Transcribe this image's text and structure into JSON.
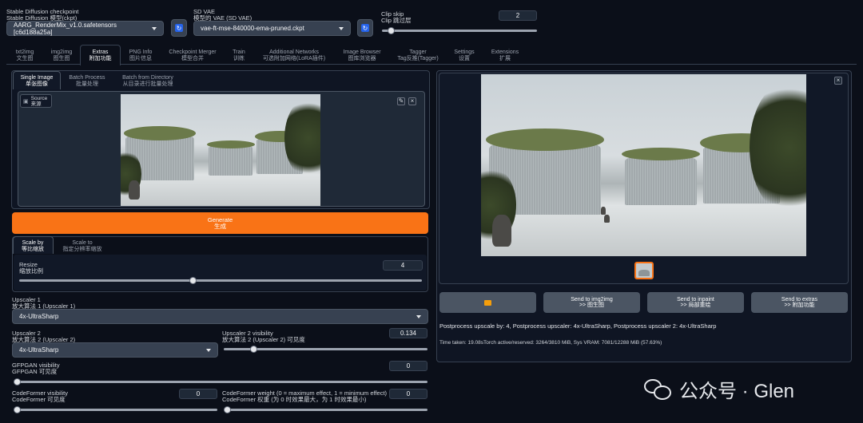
{
  "top": {
    "checkpoint_label_en": "Stable Diffusion checkpoint",
    "checkpoint_label_zh": "Stable Diffusion 模型(ckpt)",
    "checkpoint_value": "AARG_RenderMix_v1.0.safetensors [c6d188a25a]",
    "vae_label_en": "SD VAE",
    "vae_label_zh": "模型的 VAE (SD VAE)",
    "vae_value": "vae-ft-mse-840000-ema-pruned.ckpt",
    "clip_label_en": "Clip skip",
    "clip_label_zh": "Clip 跳过层",
    "clip_value": "2",
    "clip_fraction": 0.04
  },
  "tabs": [
    {
      "en": "txt2img",
      "zh": "文生图"
    },
    {
      "en": "img2img",
      "zh": "图生图"
    },
    {
      "en": "Extras",
      "zh": "附加功能"
    },
    {
      "en": "PNG Info",
      "zh": "图片信息"
    },
    {
      "en": "Checkpoint Merger",
      "zh": "模型合并"
    },
    {
      "en": "Train",
      "zh": "训练"
    },
    {
      "en": "Additional Networks",
      "zh": "可选附加网络(LoRA插件)"
    },
    {
      "en": "Image Browser",
      "zh": "图库浏览器"
    },
    {
      "en": "Tagger",
      "zh": "Tag反推(Tagger)"
    },
    {
      "en": "Settings",
      "zh": "设置"
    },
    {
      "en": "Extensions",
      "zh": "扩展"
    }
  ],
  "subtabs": [
    {
      "en": "Single Image",
      "zh": "单张图像"
    },
    {
      "en": "Batch Process",
      "zh": "批量处理"
    },
    {
      "en": "Batch from Directory",
      "zh": "从目录进行批量处理"
    }
  ],
  "source": {
    "en": "Source",
    "zh": "来源"
  },
  "generate": {
    "en": "Generate",
    "zh": "生成"
  },
  "scale_tabs": [
    {
      "en": "Scale by",
      "zh": "等比缩放"
    },
    {
      "en": "Scale to",
      "zh": "指定分辨率缩放"
    }
  ],
  "resize": {
    "label_en": "Resize",
    "label_zh": "缩放比例",
    "value": "4",
    "fraction": 0.43
  },
  "upscaler1": {
    "label_en": "Upscaler 1",
    "label_zh": "放大算法 1 (Upscaler 1)",
    "value": "4x-UltraSharp"
  },
  "upscaler2": {
    "label_en": "Upscaler 2",
    "label_zh": "放大算法 2 (Upscaler 2)",
    "value": "4x-UltraSharp"
  },
  "upscaler2_vis": {
    "label_en": "Upscaler 2 visibility",
    "label_zh": "放大算法 2 (Upscaler 2) 可见度",
    "value": "0.134",
    "fraction": 0.134
  },
  "gfpgan": {
    "label_en": "GFPGAN visibility",
    "label_zh": "GFPGAN 可见度",
    "value": "0",
    "fraction": 0
  },
  "codeformer_vis": {
    "label_en": "CodeFormer visibility",
    "label_zh": "CodeFormer 可见度",
    "value": "0",
    "fraction": 0
  },
  "codeformer_weight": {
    "label_en": "CodeFormer weight (0 = maximum effect, 1 = minimum effect)",
    "label_zh": "CodeFormer 权重 (为 0 时效果最大，为 1 时效果最小)",
    "value": "0",
    "fraction": 0
  },
  "actions": {
    "folder_icon": "folder-icon",
    "img2img_en": "Send to img2img",
    "img2img_zh": ">> 图生图",
    "inpaint_en": "Send to inpaint",
    "inpaint_zh": ">> 局部重绘",
    "extras_en": "Send to extras",
    "extras_zh": ">> 附加功能"
  },
  "info": "Postprocess upscale by: 4, Postprocess upscaler: 4x-UltraSharp, Postprocess upscaler 2: 4x-UltraSharp",
  "timing": "Time taken: 19.08sTorch active/reserved: 3264/3810 MiB, Sys VRAM: 7081/12288 MiB (57.63%)",
  "watermark": "公众号 · Glen",
  "colors": {
    "generate": "#f97316",
    "accent": "#2563eb",
    "background": "#0b0f19"
  }
}
